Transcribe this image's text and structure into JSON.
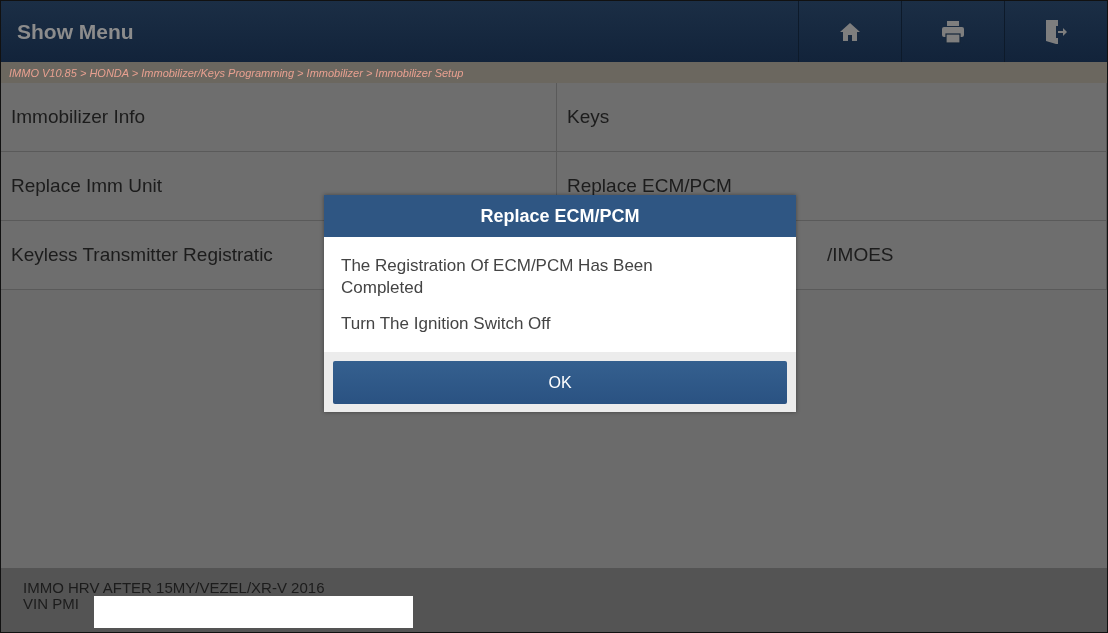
{
  "header": {
    "title": "Show Menu"
  },
  "breadcrumb": "IMMO V10.85 > HONDA > Immobilizer/Keys Programming > Immobilizer > Immobilizer Setup",
  "menu_items": [
    {
      "label": "Immobilizer Info",
      "cut_by_dialog": false
    },
    {
      "label": "Keys",
      "cut_by_dialog": false
    },
    {
      "label": "Replace Imm Unit",
      "cut_by_dialog": false
    },
    {
      "label": "Replace ECM/PCM",
      "cut_by_dialog": false
    },
    {
      "label": "Keyless Transmitter Registratic",
      "cut_by_dialog": false
    },
    {
      "label": "/IMOES",
      "cut_by_dialog": true
    }
  ],
  "footer": {
    "lines": [
      "IMMO HRV AFTER 15MY/VEZEL/XR-V 2016",
      "VIN PMI"
    ]
  },
  "dialog": {
    "title": "Replace ECM/PCM",
    "messages": [
      "The Registration Of ECM/PCM Has Been Completed",
      "Turn The Ignition Switch Off"
    ],
    "button": "OK"
  }
}
